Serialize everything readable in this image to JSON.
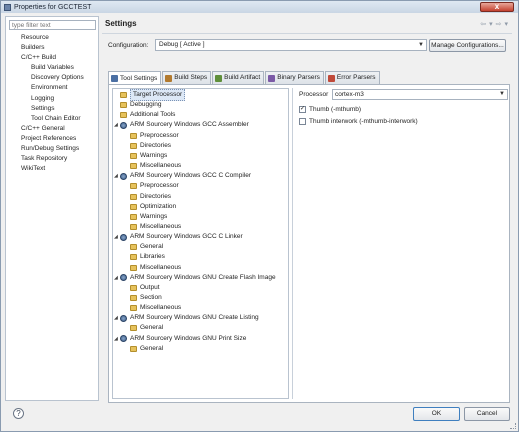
{
  "window": {
    "title": "Properties for GCCTEST",
    "close_label": "x"
  },
  "filter": {
    "placeholder": "type filter text"
  },
  "nav": [
    {
      "label": "Resource",
      "indent": 1
    },
    {
      "label": "Builders",
      "indent": 1
    },
    {
      "label": "C/C++ Build",
      "indent": 1
    },
    {
      "label": "Build Variables",
      "indent": 2
    },
    {
      "label": "Discovery Options",
      "indent": 2
    },
    {
      "label": "Environment",
      "indent": 2
    },
    {
      "label": "Logging",
      "indent": 2
    },
    {
      "label": "Settings",
      "indent": 2
    },
    {
      "label": "Tool Chain Editor",
      "indent": 2
    },
    {
      "label": "C/C++ General",
      "indent": 1
    },
    {
      "label": "Project References",
      "indent": 1
    },
    {
      "label": "Run/Debug Settings",
      "indent": 1
    },
    {
      "label": "Task Repository",
      "indent": 1
    },
    {
      "label": "WikiText",
      "indent": 1
    }
  ],
  "header": {
    "title": "Settings",
    "back_arrow": "⇦",
    "fwd_arrow": "⇨",
    "menu_arrow": "▾"
  },
  "config": {
    "label": "Configuration:",
    "value": "Debug  [ Active ]",
    "manage_label": "Manage Configurations..."
  },
  "tabs": [
    {
      "label": "Tool Settings",
      "icon": "gear-icon",
      "active": true
    },
    {
      "label": "Build Steps",
      "icon": "build-steps-icon",
      "active": false
    },
    {
      "label": "Build Artifact",
      "icon": "artifact-icon",
      "active": false
    },
    {
      "label": "Binary Parsers",
      "icon": "binary-icon",
      "active": false
    },
    {
      "label": "Error Parsers",
      "icon": "error-icon",
      "active": false
    }
  ],
  "tree": [
    {
      "label": "Target Processor",
      "level": 0,
      "type": "option",
      "selected": true
    },
    {
      "label": "Debugging",
      "level": 0,
      "type": "option"
    },
    {
      "label": "Additional Tools",
      "level": 0,
      "type": "option"
    },
    {
      "label": "ARM Sourcery Windows GCC Assembler",
      "level": 0,
      "type": "tool"
    },
    {
      "label": "Preprocessor",
      "level": 1,
      "type": "option"
    },
    {
      "label": "Directories",
      "level": 1,
      "type": "option"
    },
    {
      "label": "Warnings",
      "level": 1,
      "type": "option"
    },
    {
      "label": "Miscellaneous",
      "level": 1,
      "type": "option"
    },
    {
      "label": "ARM Sourcery Windows GCC C Compiler",
      "level": 0,
      "type": "tool"
    },
    {
      "label": "Preprocessor",
      "level": 1,
      "type": "option"
    },
    {
      "label": "Directories",
      "level": 1,
      "type": "option"
    },
    {
      "label": "Optimization",
      "level": 1,
      "type": "option"
    },
    {
      "label": "Warnings",
      "level": 1,
      "type": "option"
    },
    {
      "label": "Miscellaneous",
      "level": 1,
      "type": "option"
    },
    {
      "label": "ARM Sourcery Windows GCC C Linker",
      "level": 0,
      "type": "tool"
    },
    {
      "label": "General",
      "level": 1,
      "type": "option"
    },
    {
      "label": "Libraries",
      "level": 1,
      "type": "option"
    },
    {
      "label": "Miscellaneous",
      "level": 1,
      "type": "option"
    },
    {
      "label": "ARM Sourcery Windows GNU Create Flash Image",
      "level": 0,
      "type": "tool"
    },
    {
      "label": "Output",
      "level": 1,
      "type": "option"
    },
    {
      "label": "Section",
      "level": 1,
      "type": "option"
    },
    {
      "label": "Miscellaneous",
      "level": 1,
      "type": "option"
    },
    {
      "label": "ARM Sourcery Windows GNU Create Listing",
      "level": 0,
      "type": "tool"
    },
    {
      "label": "General",
      "level": 1,
      "type": "option"
    },
    {
      "label": "ARM Sourcery Windows GNU Print Size",
      "level": 0,
      "type": "tool"
    },
    {
      "label": "General",
      "level": 1,
      "type": "option"
    }
  ],
  "processor": {
    "label": "Processor",
    "value": "cortex-m3"
  },
  "checkboxes": [
    {
      "label": "Thumb (-mthumb)",
      "checked": true,
      "mark": "✓"
    },
    {
      "label": "Thumb interwork (-mthumb-interwork)",
      "checked": false,
      "mark": ""
    }
  ],
  "buttons": {
    "help": "?",
    "ok": "OK",
    "cancel": "Cancel"
  }
}
